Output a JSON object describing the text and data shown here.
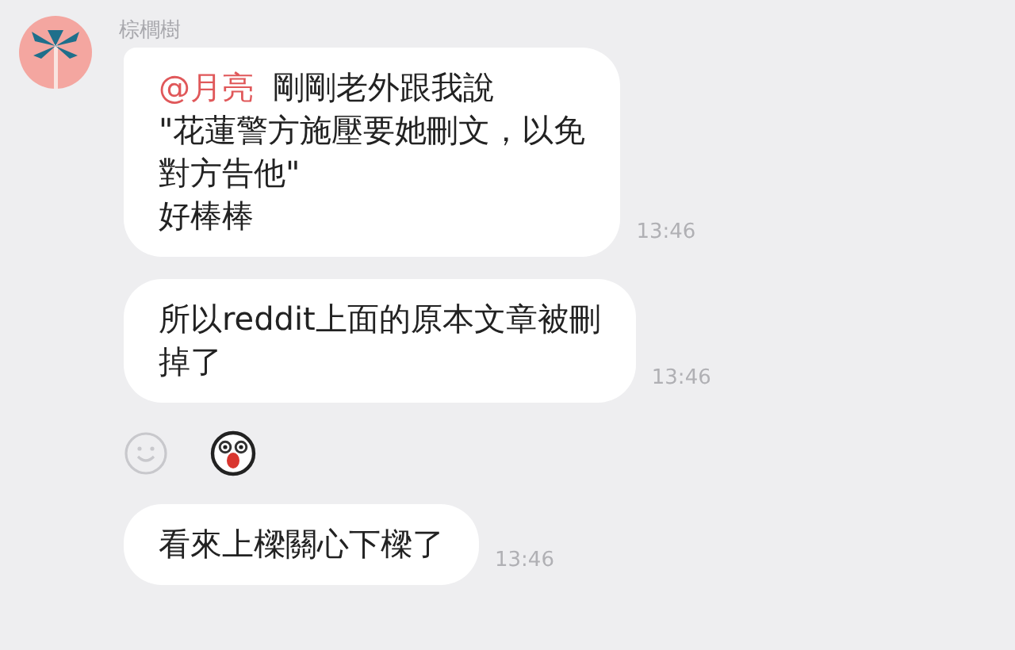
{
  "sender": {
    "name": "棕櫚樹"
  },
  "messages": [
    {
      "kind": "text",
      "mention": "@月亮",
      "lines": [
        "剛剛老外跟我說",
        "\"花蓮警方施壓要她刪文，以免",
        "對方告他\"",
        "好棒棒"
      ],
      "time": "13:46"
    },
    {
      "kind": "text",
      "lines": [
        "所以reddit上面的原本文章被刪",
        "掉了"
      ],
      "time": "13:46"
    },
    {
      "kind": "reaction"
    },
    {
      "kind": "text",
      "lines": [
        "看來上樑關心下樑了"
      ],
      "time": "13:46"
    }
  ]
}
